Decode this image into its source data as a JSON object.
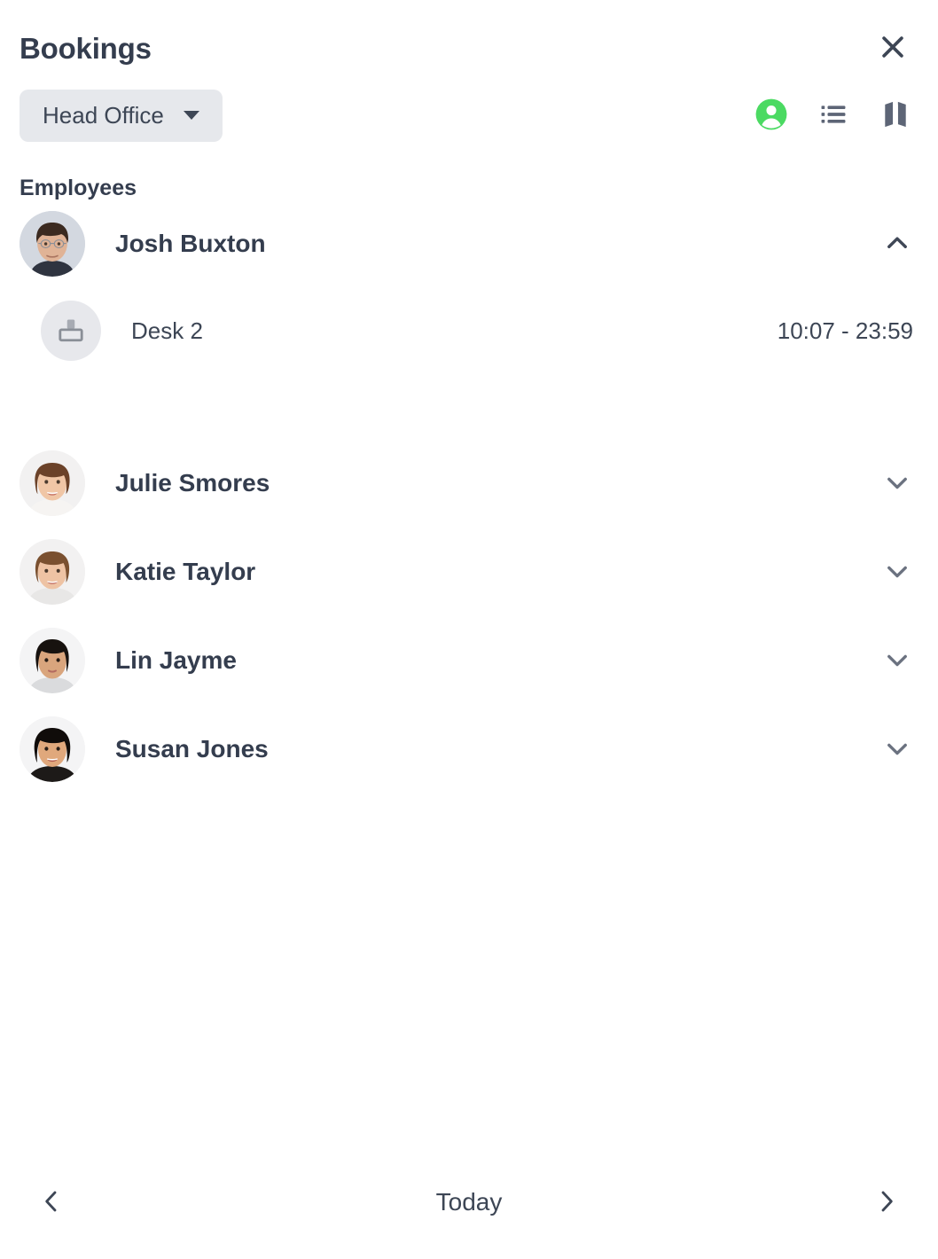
{
  "header": {
    "title": "Bookings",
    "close_icon": "close-icon"
  },
  "toolbar": {
    "office_filter": {
      "value": "Head Office",
      "caret_icon": "chevron-down-icon"
    },
    "icons": [
      {
        "name": "person-icon",
        "active": true,
        "color": "#4bda62"
      },
      {
        "name": "list-icon",
        "active": false,
        "color": "#5d6576"
      },
      {
        "name": "map-icon",
        "active": false,
        "color": "#5d6576"
      }
    ]
  },
  "main": {
    "section_title": "Employees",
    "employees": [
      {
        "name": "Josh Buxton",
        "expanded": true,
        "chevron_icon": "chevron-up-icon",
        "avatar_bg": "#d3d8e0",
        "bookings": [
          {
            "resource": "Desk 2",
            "time": "10:07 - 23:59",
            "icon": "desk-icon"
          }
        ]
      },
      {
        "name": "Julie Smores",
        "expanded": false,
        "chevron_icon": "chevron-down-icon",
        "avatar_bg": "#f2f1f1",
        "bookings": []
      },
      {
        "name": "Katie Taylor",
        "expanded": false,
        "chevron_icon": "chevron-down-icon",
        "avatar_bg": "#f2f1f1",
        "bookings": []
      },
      {
        "name": "Lin Jayme",
        "expanded": false,
        "chevron_icon": "chevron-down-icon",
        "avatar_bg": "#f4f4f5",
        "bookings": []
      },
      {
        "name": "Susan Jones",
        "expanded": false,
        "chevron_icon": "chevron-down-icon",
        "avatar_bg": "#f4f4f5",
        "bookings": []
      }
    ]
  },
  "footer": {
    "prev_icon": "chevron-left-icon",
    "label": "Today",
    "next_icon": "chevron-right-icon"
  },
  "colors": {
    "text_primary": "#343d4e",
    "text_secondary": "#3d4655",
    "chevron_collapsed": "#6b7280",
    "chevron_expanded": "#3f4756",
    "accent_green": "#4bda62",
    "chip_bg": "#e6e8ec",
    "icon_grey": "#5d6576"
  }
}
